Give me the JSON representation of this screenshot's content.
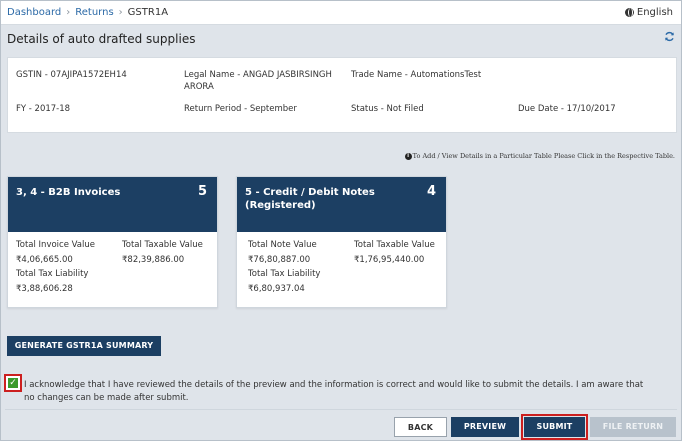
{
  "breadcrumb": {
    "items": [
      "Dashboard",
      "Returns"
    ],
    "current": "GSTR1A"
  },
  "language": "English",
  "page_title": "Details of auto drafted supplies",
  "refresh_icon": "refresh-icon",
  "info": {
    "gstin": "GSTIN - 07AJIPA1572EH14",
    "legal_name_line1": "Legal Name - ANGAD JASBIRSINGH",
    "legal_name_line2": "ARORA",
    "trade_name": "Trade Name - AutomationsTest",
    "fy": "FY - 2017-18",
    "return_period": "Return Period - September",
    "status": "Status - Not Filed",
    "due_date": "Due Date - 17/10/2017"
  },
  "hint": "To Add / View Details in a Particular Table Please Click in the Respective Table.",
  "cards": [
    {
      "title_line1": "3, 4 - B2B Invoices",
      "title_line2": "",
      "count": "5",
      "stats": [
        {
          "label": "Total Invoice Value",
          "value": "₹4,06,665.00"
        },
        {
          "label": "Total Taxable Value",
          "value": "₹82,39,886.00"
        },
        {
          "label": "Total Tax Liability",
          "value": "₹3,88,606.28"
        }
      ]
    },
    {
      "title_line1": "5 - Credit / Debit Notes",
      "title_line2": "(Registered)",
      "count": "4",
      "stats": [
        {
          "label": "Total Note Value",
          "value": "₹76,80,887.00"
        },
        {
          "label": "Total Taxable Value",
          "value": "₹1,76,95,440.00"
        },
        {
          "label": "Total Tax Liability",
          "value": "₹6,80,937.04"
        }
      ]
    }
  ],
  "buttons": {
    "generate_summary": "GENERATE GSTR1A SUMMARY",
    "back": "BACK",
    "preview": "PREVIEW",
    "submit": "SUBMIT",
    "file_return": "FILE RETURN"
  },
  "acknowledgement": {
    "checked": true,
    "text": "I acknowledge that I have reviewed the details of the preview and the information is correct and would like to submit the details. I am aware that no changes can be made after submit."
  },
  "colors": {
    "primary": "#1c3f63",
    "link": "#2c6aa7",
    "highlight": "#cc1f1f",
    "checkbox": "#3a9a2b",
    "disabled": "#b8c2cc"
  }
}
